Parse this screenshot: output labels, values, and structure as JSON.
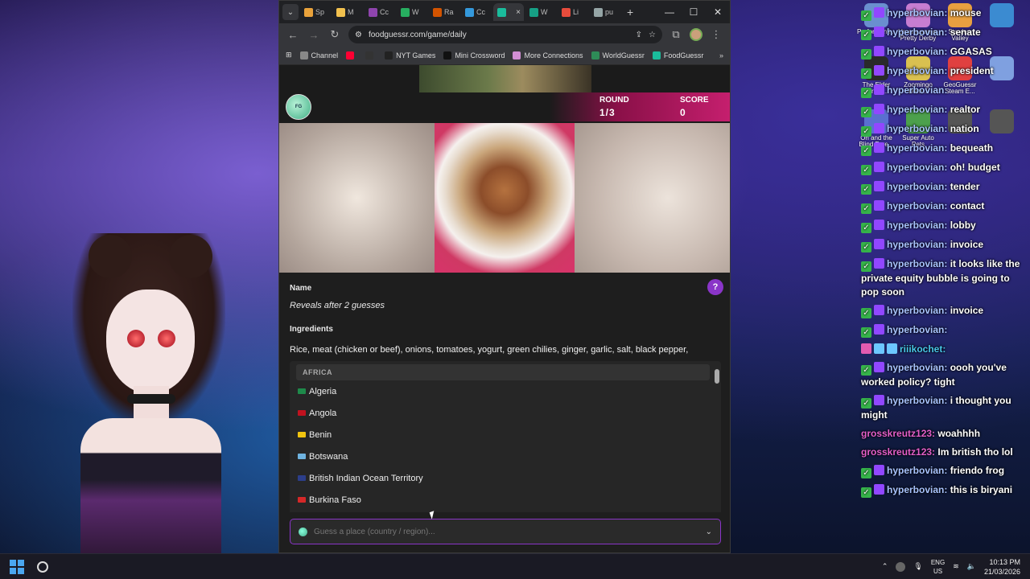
{
  "desktop_icons": [
    {
      "label": "Performanti..."
    },
    {
      "label": "Umamusume: Pretty Derby"
    },
    {
      "label": "Stardew Valley"
    },
    {
      "label": ""
    },
    {
      "label": "The Elder Scrolls..."
    },
    {
      "label": "Zoomingo Dem..."
    },
    {
      "label": "GeoGuessr Steam E..."
    },
    {
      "label": ""
    },
    {
      "label": "Oh and the Blind Fore..."
    },
    {
      "label": "Super Auto Pets"
    },
    {
      "label": ""
    },
    {
      "label": ""
    }
  ],
  "browser": {
    "tabs": [
      {
        "short": "Sp",
        "color": "#e9a23b"
      },
      {
        "short": "M",
        "color": "#f2c14e"
      },
      {
        "short": "Cc",
        "color": "#8e44ad"
      },
      {
        "short": "W",
        "color": "#27ae60"
      },
      {
        "short": "Ra",
        "color": "#d35400"
      },
      {
        "short": "Cc",
        "color": "#3498db"
      },
      {
        "short": "",
        "color": "#1abc9c",
        "active": true
      },
      {
        "short": "W",
        "color": "#16a085"
      },
      {
        "short": "Li",
        "color": "#e74c3c"
      },
      {
        "short": "pu",
        "color": "#95a5a6"
      }
    ],
    "url": "foodguessr.com/game/daily",
    "bookmarks": [
      {
        "label": "Channel",
        "color": "#888"
      },
      {
        "label": "",
        "color": "#ff0033"
      },
      {
        "label": "",
        "color": "#333"
      },
      {
        "label": "NYT Games",
        "color": "#222"
      },
      {
        "label": "Mini Crossword",
        "color": "#111"
      },
      {
        "label": "More Connections",
        "color": "#d28fd5"
      },
      {
        "label": "WorldGuessr",
        "color": "#2e8b57"
      },
      {
        "label": "FoodGuessr",
        "color": "#1abc9c"
      }
    ]
  },
  "game": {
    "round_label": "ROUND",
    "round_value": "1/3",
    "score_label": "SCORE",
    "score_value": "0",
    "name_label": "Name",
    "name_value": "Reveals after 2 guesses",
    "ingredients_label": "Ingredients",
    "ingredients_value": "Rice, meat (chicken or beef), onions, tomatoes, yogurt, green chilies, ginger, garlic, salt, black pepper,",
    "help_icon": "question-icon",
    "dropdown": {
      "group": "AFRICA",
      "items": [
        {
          "label": "Algeria",
          "flag": "#1e8a4a"
        },
        {
          "label": "Angola",
          "flag": "#c1121f"
        },
        {
          "label": "Benin",
          "flag": "#f1c40f"
        },
        {
          "label": "Botswana",
          "flag": "#6fb3e0"
        },
        {
          "label": "British Indian Ocean Territory",
          "flag": "#2c3e8a"
        },
        {
          "label": "Burkina Faso",
          "flag": "#d62828"
        }
      ]
    },
    "guess_placeholder": "Guess a place (country / region)..."
  },
  "chat": [
    {
      "user": "hyperbovian:",
      "text": "mouse",
      "color": "default"
    },
    {
      "user": "hyperbovian:",
      "text": "senate",
      "color": "default"
    },
    {
      "user": "hyperbovian:",
      "text": "GGASAS",
      "color": "default"
    },
    {
      "user": "hyperbovian:",
      "text": "president",
      "color": "default"
    },
    {
      "user": "hyperbovian:",
      "text": "",
      "color": "default"
    },
    {
      "user": "hyperbovian:",
      "text": "realtor",
      "color": "default"
    },
    {
      "user": "hyperbovian:",
      "text": "nation",
      "color": "default"
    },
    {
      "user": "hyperbovian:",
      "text": "bequeath",
      "color": "default"
    },
    {
      "user": "hyperbovian:",
      "text": "oh! budget",
      "color": "default"
    },
    {
      "user": "hyperbovian:",
      "text": "tender",
      "color": "default"
    },
    {
      "user": "hyperbovian:",
      "text": "contact",
      "color": "default"
    },
    {
      "user": "hyperbovian:",
      "text": "lobby",
      "color": "default"
    },
    {
      "user": "hyperbovian:",
      "text": "invoice",
      "color": "default"
    },
    {
      "user": "hyperbovian:",
      "text": "it looks like the private equity bubble is going to pop soon",
      "color": "default"
    },
    {
      "user": "hyperbovian:",
      "text": "invoice",
      "color": "default"
    },
    {
      "user": "hyperbovian:",
      "text": "",
      "color": "default"
    },
    {
      "user": "riiikochet:",
      "text": "",
      "color": "teal",
      "special": true
    },
    {
      "user": "hyperbovian:",
      "text": "oooh you've worked policy? tight",
      "color": "default"
    },
    {
      "user": "hyperbovian:",
      "text": "i thought you might",
      "color": "default"
    },
    {
      "user": "grosskreutz123:",
      "text": "woahhhh",
      "color": "pink",
      "nobadge": true
    },
    {
      "user": "grosskreutz123:",
      "text": "Im british tho lol",
      "color": "pink",
      "nobadge": true
    },
    {
      "user": "hyperbovian:",
      "text": "friendo frog",
      "color": "default"
    },
    {
      "user": "hyperbovian:",
      "text": "this is biryani",
      "color": "default"
    }
  ],
  "taskbar": {
    "lang_top": "ENG",
    "lang_bottom": "US",
    "time": "10:13 PM",
    "date": "21/03/2026"
  }
}
